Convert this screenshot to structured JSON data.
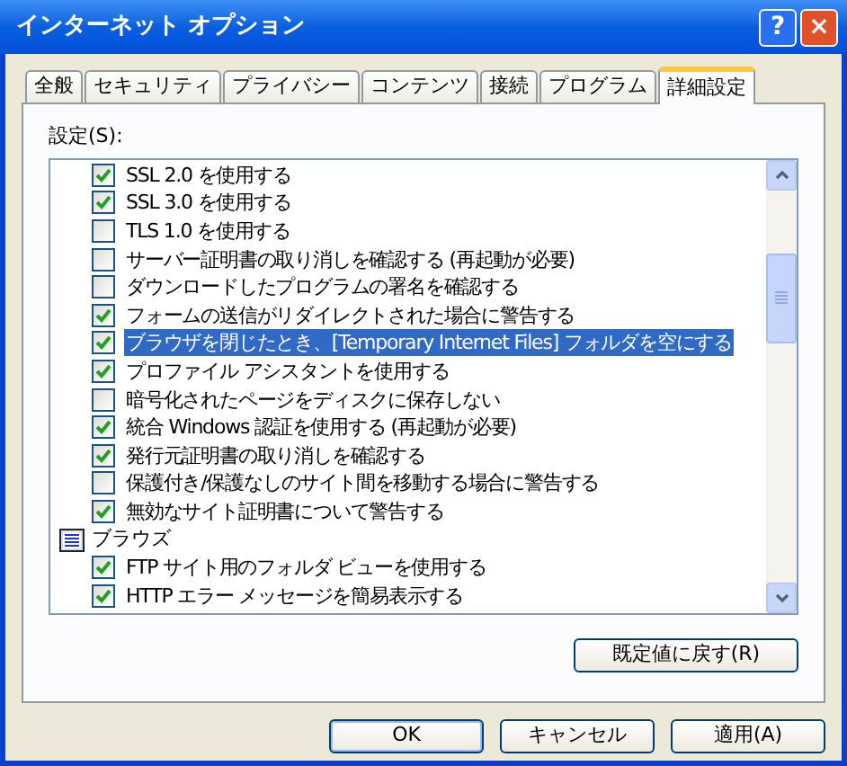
{
  "window": {
    "title": "インターネット オプション"
  },
  "title_buttons": [
    "?",
    "×"
  ],
  "tabs": [
    {
      "label": "全般",
      "selected": false
    },
    {
      "label": "セキュリティ",
      "selected": false
    },
    {
      "label": "プライバシー",
      "selected": false
    },
    {
      "label": "コンテンツ",
      "selected": false
    },
    {
      "label": "接続",
      "selected": false
    },
    {
      "label": "プログラム",
      "selected": false
    },
    {
      "label": "詳細設定",
      "selected": true
    }
  ],
  "settings_label": "設定(S):",
  "settings": [
    {
      "kind": "checkbox",
      "label": "SSL 2.0 を使用する",
      "checked": true,
      "selected": false
    },
    {
      "kind": "checkbox",
      "label": "SSL 3.0 を使用する",
      "checked": true,
      "selected": false
    },
    {
      "kind": "checkbox",
      "label": "TLS 1.0 を使用する",
      "checked": false,
      "selected": false
    },
    {
      "kind": "checkbox",
      "label": "サーバー証明書の取り消しを確認する (再起動が必要)",
      "checked": false,
      "selected": false
    },
    {
      "kind": "checkbox",
      "label": "ダウンロードしたプログラムの署名を確認する",
      "checked": false,
      "selected": false
    },
    {
      "kind": "checkbox",
      "label": "フォームの送信がリダイレクトされた場合に警告する",
      "checked": true,
      "selected": false
    },
    {
      "kind": "checkbox",
      "label": "ブラウザを閉じたとき、[Temporary Internet Files] フォルダを空にする",
      "checked": true,
      "selected": true
    },
    {
      "kind": "checkbox",
      "label": "プロファイル アシスタントを使用する",
      "checked": true,
      "selected": false
    },
    {
      "kind": "checkbox",
      "label": "暗号化されたページをディスクに保存しない",
      "checked": false,
      "selected": false
    },
    {
      "kind": "checkbox",
      "label": "統合 Windows 認証を使用する (再起動が必要)",
      "checked": true,
      "selected": false
    },
    {
      "kind": "checkbox",
      "label": "発行元証明書の取り消しを確認する",
      "checked": true,
      "selected": false
    },
    {
      "kind": "checkbox",
      "label": "保護付き/保護なしのサイト間を移動する場合に警告する",
      "checked": false,
      "selected": false
    },
    {
      "kind": "checkbox",
      "label": "無効なサイト証明書について警告する",
      "checked": true,
      "selected": false
    },
    {
      "kind": "category",
      "label": "ブラウズ",
      "selected": false
    },
    {
      "kind": "checkbox",
      "label": "FTP サイト用のフォルダ ビューを使用する",
      "checked": true,
      "selected": false
    },
    {
      "kind": "checkbox",
      "label": "HTTP エラー メッセージを簡易表示する",
      "checked": true,
      "selected": false
    }
  ],
  "reset_button": "既定値に戻す(R)",
  "buttons": [
    "OK",
    "キャンセル",
    "適用(A)"
  ]
}
